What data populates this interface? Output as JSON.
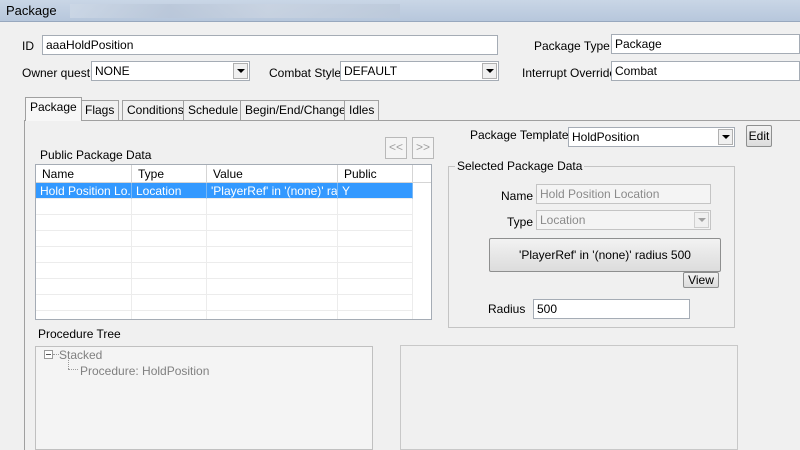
{
  "window": {
    "title": "Package"
  },
  "fields": {
    "id_label": "ID",
    "id_value": "aaaHoldPosition",
    "package_type_label": "Package Type",
    "package_type_value": "Package",
    "owner_quest_label": "Owner quest",
    "owner_quest_value": "NONE",
    "combat_style_label": "Combat Style",
    "combat_style_value": "DEFAULT",
    "interrupt_override_label": "Interrupt Override",
    "interrupt_override_value": "Combat"
  },
  "tabs": [
    {
      "label": "Package",
      "active": true
    },
    {
      "label": "Flags",
      "active": false
    },
    {
      "label": "Conditions",
      "active": false
    },
    {
      "label": "Schedule",
      "active": false
    },
    {
      "label": "Begin/End/Change",
      "active": false
    },
    {
      "label": "Idles",
      "active": false
    }
  ],
  "nav": {
    "prev_label": "<<",
    "next_label": ">>"
  },
  "public_data": {
    "title": "Public Package Data",
    "columns": [
      "Name",
      "Type",
      "Value",
      "Public"
    ],
    "rows": [
      {
        "name": "Hold Position Lo...",
        "type": "Location",
        "value": "'PlayerRef' in '(none)' ra...",
        "public": "Y"
      }
    ]
  },
  "template": {
    "label": "Package Template",
    "value": "HoldPosition",
    "edit_label": "Edit"
  },
  "selected": {
    "title": "Selected Package Data",
    "name_label": "Name",
    "name_value": "Hold Position Location",
    "type_label": "Type",
    "type_value": "Location",
    "location_text": "'PlayerRef' in '(none)' radius 500",
    "view_label": "View",
    "radius_label": "Radius",
    "radius_value": "500"
  },
  "procedure_tree": {
    "title": "Procedure Tree",
    "root": "Stacked",
    "child": "Procedure: HoldPosition"
  },
  "colors": {
    "selection": "#3399ff",
    "titlebar": "#c9d6e6"
  }
}
